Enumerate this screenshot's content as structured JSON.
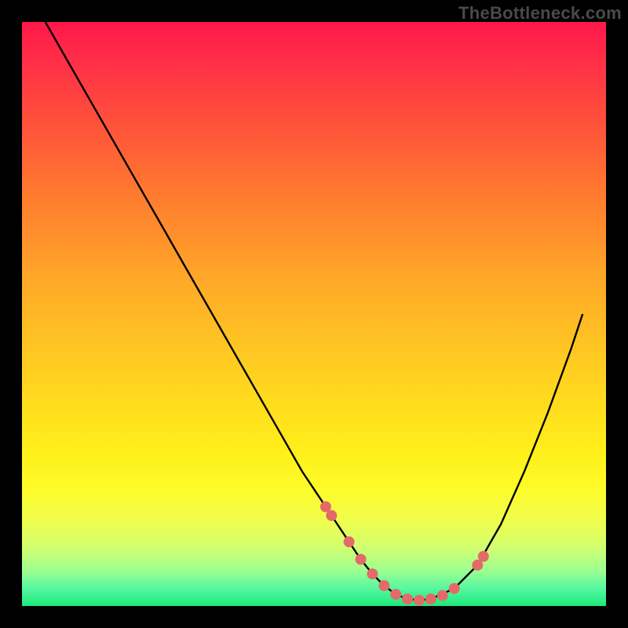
{
  "watermark": "TheBottleneck.com",
  "colors": {
    "page_bg": "#000000",
    "gradient_top": "#ff184a",
    "gradient_bottom": "#1ae97a",
    "curve_stroke": "#000000",
    "dot_fill": "#e46a6a"
  },
  "chart_data": {
    "type": "line",
    "title": "",
    "xlabel": "",
    "ylabel": "",
    "xlim": [
      0,
      100
    ],
    "ylim": [
      0,
      100
    ],
    "series": [
      {
        "name": "curve",
        "x": [
          4,
          8,
          12,
          16,
          20,
          24,
          28,
          32,
          36,
          40,
          44,
          48,
          52,
          56,
          58,
          60,
          62,
          64,
          66,
          68,
          70,
          74,
          78,
          82,
          86,
          90,
          94,
          96
        ],
        "y": [
          100,
          93,
          86,
          79,
          72,
          65,
          58,
          51,
          44,
          37,
          30,
          23,
          17,
          11,
          8,
          5.5,
          3.5,
          2,
          1.2,
          1,
          1.2,
          3,
          7,
          14,
          23,
          33,
          44,
          50
        ]
      }
    ],
    "markers": {
      "name": "dots",
      "x": [
        52,
        53,
        56,
        58,
        60,
        62,
        64,
        66,
        68,
        70,
        72,
        74,
        78,
        79
      ],
      "y": [
        17,
        15.5,
        11,
        8,
        5.5,
        3.5,
        2,
        1.2,
        1,
        1.2,
        1.8,
        3,
        7,
        8.5
      ]
    }
  }
}
